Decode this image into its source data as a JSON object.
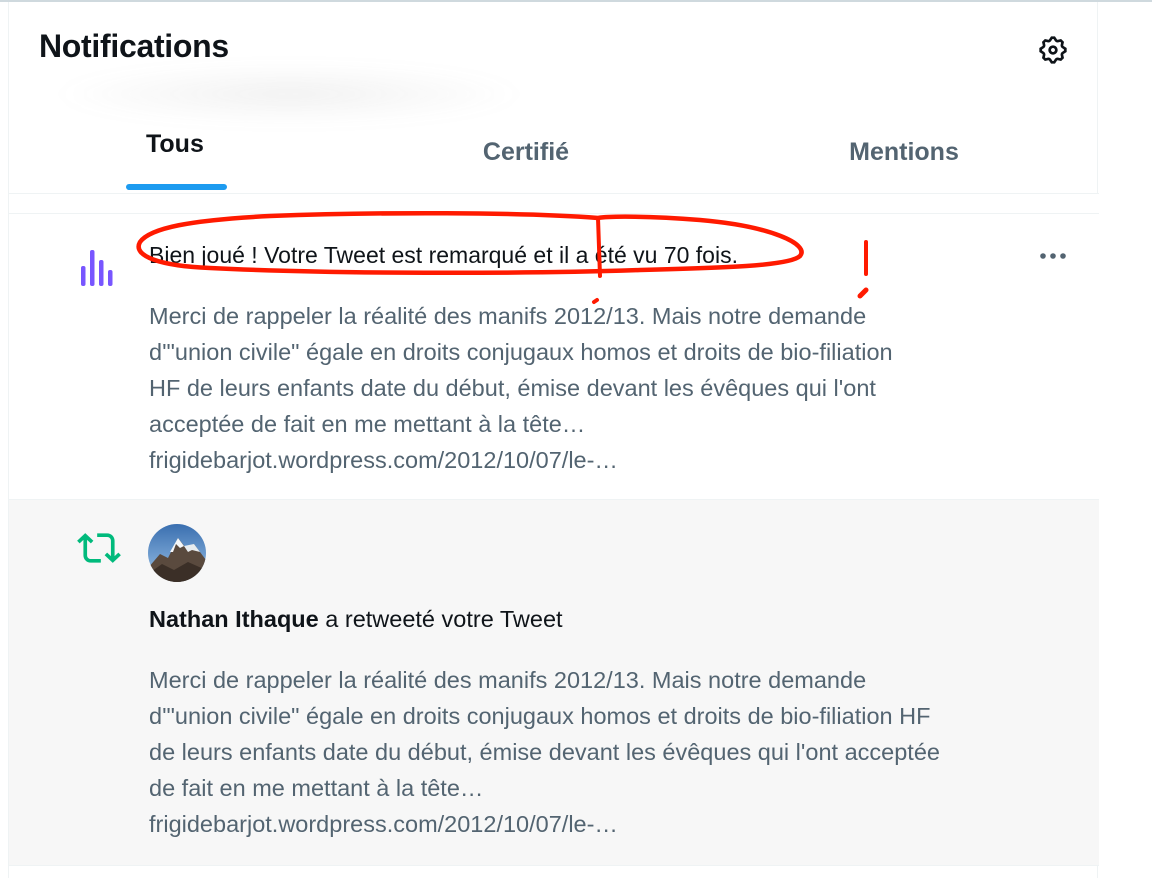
{
  "header": {
    "title": "Notifications",
    "settings_icon": "gear-icon"
  },
  "tabs": [
    {
      "label": "Tous",
      "active": true
    },
    {
      "label": "Certifié",
      "active": false
    },
    {
      "label": "Mentions",
      "active": false
    }
  ],
  "notifications": [
    {
      "type": "views",
      "icon": "analytics-icon",
      "icon_color": "#7856ff",
      "headline": "Bien joué ! Votre Tweet est remarqué et il a été vu 70 fois.",
      "more_icon": "more-icon",
      "tweet_text": "Merci de rappeler la réalité des manifs 2012/13. Mais notre demande\nd'\"union civile\" égale en droits conjugaux homos et droits de bio-filiation\nHF de leurs enfants date du début, émise devant les évêques qui l'ont\nacceptée de fait en me mettant à la tête…\nfrigidebarjot.wordpress.com/2012/10/07/le-…"
    },
    {
      "type": "retweet",
      "icon": "retweet-icon",
      "icon_color": "#00ba7c",
      "user_name": "Nathan Ithaque",
      "action_text": " a retweeté votre Tweet",
      "tweet_text": "Merci de rappeler la réalité des manifs 2012/13. Mais notre demande\nd'\"union civile\" égale en droits conjugaux homos et droits de bio-filiation HF\nde leurs enfants date du début, émise devant les évêques qui l'ont acceptée\nde fait en me mettant à la tête…\nfrigidebarjot.wordpress.com/2012/10/07/le-…"
    }
  ],
  "colors": {
    "accent": "#1d9bf0",
    "annotation": "#ff1a00",
    "text_primary": "#0f1419",
    "text_secondary": "#536471"
  }
}
